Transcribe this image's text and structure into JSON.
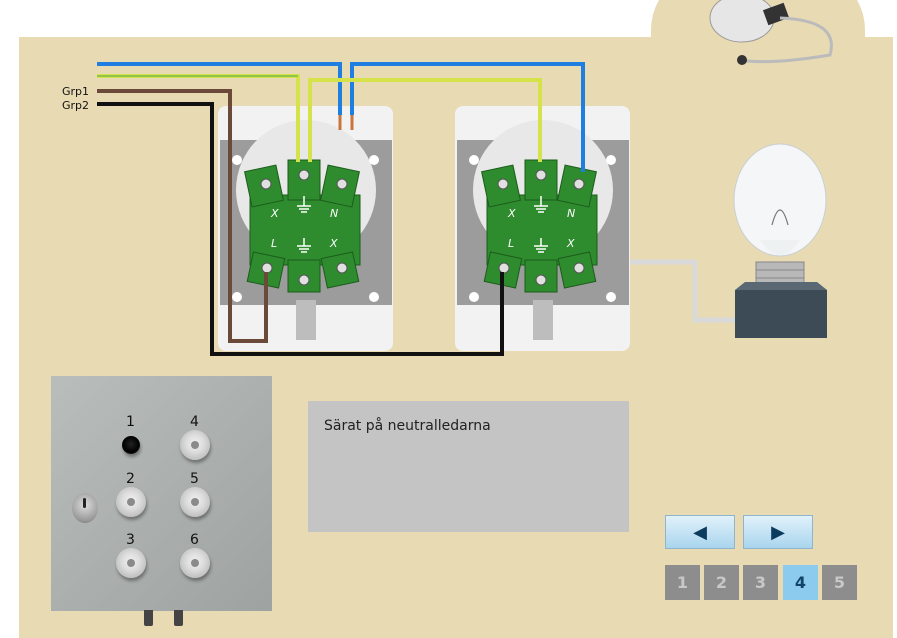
{
  "wiring": {
    "group1_label": "Grp1",
    "group2_label": "Grp2",
    "socket1": {
      "terminal_labels": [
        "X",
        "N",
        "L",
        "X"
      ]
    },
    "socket2": {
      "terminal_labels": [
        "X",
        "N",
        "L",
        "X"
      ]
    }
  },
  "tester": {
    "points": [
      {
        "label": "1"
      },
      {
        "label": "2"
      },
      {
        "label": "3"
      },
      {
        "label": "4"
      },
      {
        "label": "5"
      },
      {
        "label": "6"
      }
    ]
  },
  "info": {
    "text": "Särat på neutralledarna"
  },
  "nav": {
    "prev_icon": "arrow-left-icon",
    "next_icon": "arrow-right-icon",
    "prev_glyph": "◀",
    "next_glyph": "▶",
    "pages": [
      "1",
      "2",
      "3",
      "4",
      "5"
    ],
    "active_page": "4"
  },
  "colors": {
    "background": "#e8dab3",
    "wire_blue": "#1f7fe0",
    "wire_yellow_green": "#d6e24a",
    "wire_brown": "#6b4a3a",
    "wire_black": "#111111",
    "terminal_green": "#2e8b2e",
    "page_active": "#8ccbee"
  }
}
